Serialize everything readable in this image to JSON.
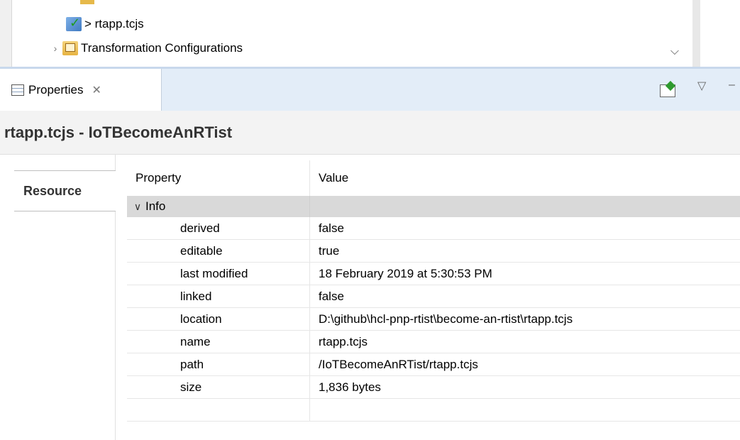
{
  "tree": {
    "items": [
      {
        "label": "> rtapp.tcjs",
        "icon": "tcjs-file-icon"
      },
      {
        "label": "Transformation Configurations",
        "icon": "transformation-folder-icon",
        "expander": "chevron-right"
      }
    ],
    "scroll_icon": "chevron-down-icon"
  },
  "properties_view": {
    "tab_label": "Properties",
    "tab_close_symbol": "✕",
    "header_title": "rtapp.tcjs - IoTBecomeAnRTist",
    "tabs": [
      {
        "label": "Resource"
      }
    ],
    "table": {
      "columns": [
        "Property",
        "Value"
      ],
      "group": {
        "label": "Info"
      },
      "rows": [
        {
          "property": "derived",
          "value": "false"
        },
        {
          "property": "editable",
          "value": "true"
        },
        {
          "property": "last modified",
          "value": "18 February 2019 at 5:30:53 PM"
        },
        {
          "property": "linked",
          "value": "false"
        },
        {
          "property": "location",
          "value": "D:\\github\\hcl-pnp-rtist\\become-an-rtist\\rtapp.tcjs"
        },
        {
          "property": "name",
          "value": "rtapp.tcjs"
        },
        {
          "property": "path",
          "value": "/IoTBecomeAnRTist/rtapp.tcjs"
        },
        {
          "property": "size",
          "value": "1,836  bytes"
        }
      ]
    }
  }
}
